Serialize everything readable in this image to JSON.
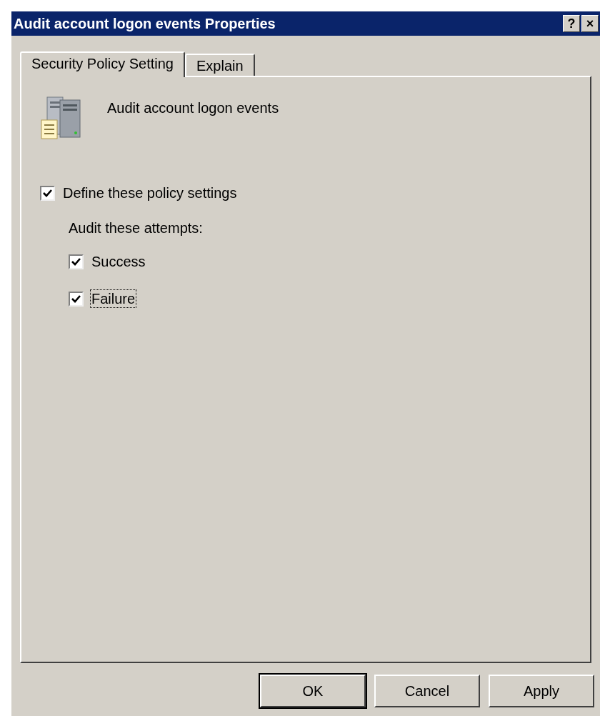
{
  "window": {
    "title": "Audit account logon events Properties",
    "title_buttons": [
      "?",
      "×"
    ]
  },
  "tabs": [
    {
      "label": "Security Policy Setting",
      "selected": true
    },
    {
      "label": "Explain",
      "selected": false
    }
  ],
  "policy": {
    "name": "Audit account logon events"
  },
  "define": {
    "label": "Define these policy settings",
    "checked": true,
    "focused": false
  },
  "attempts_label": "Audit these attempts:",
  "attempts": [
    {
      "label": "Success",
      "checked": true,
      "focused": false
    },
    {
      "label": "Failure",
      "checked": true,
      "focused": true
    }
  ],
  "buttons": [
    {
      "label": "OK",
      "default": true
    },
    {
      "label": "Cancel",
      "default": false
    },
    {
      "label": "Apply",
      "default": false
    }
  ]
}
